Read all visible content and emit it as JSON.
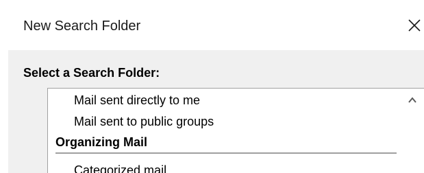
{
  "window": {
    "title": "New Search Folder",
    "close_icon": "close-icon"
  },
  "dialog": {
    "section_label": "Select a Search Folder:",
    "list": {
      "items_before": [
        {
          "label": "Mail sent directly to me"
        },
        {
          "label": "Mail sent to public groups"
        }
      ],
      "group": {
        "label": "Organizing Mail",
        "items": [
          {
            "label": "Categorized mail"
          }
        ]
      },
      "scroll_up_icon": "chevron-up-icon"
    }
  }
}
